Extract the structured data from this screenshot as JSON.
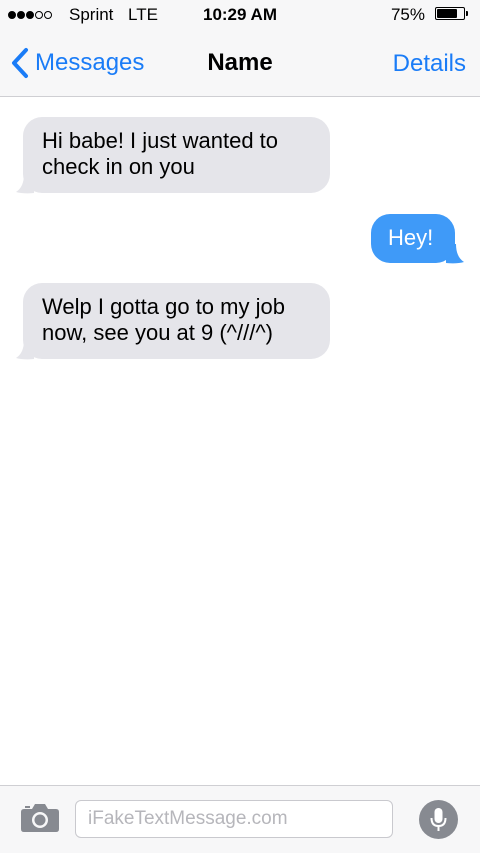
{
  "status_bar": {
    "signal_filled": 3,
    "signal_total": 5,
    "carrier": "Sprint",
    "network": "LTE",
    "time": "10:29 AM",
    "battery_percent": "75%",
    "battery_level": 0.75
  },
  "nav": {
    "back_label": "Messages",
    "title": "Name",
    "details_label": "Details",
    "back_icon": "chevron-left-icon"
  },
  "messages": [
    {
      "direction": "incoming",
      "text": "Hi babe! I just wanted to check in on you"
    },
    {
      "direction": "outgoing",
      "text": "Hey!"
    },
    {
      "direction": "incoming",
      "text": "Welp I gotta go to my job now, see you at 9 (^///^)"
    }
  ],
  "input_bar": {
    "placeholder": "iFakeTextMessage.com",
    "value": "",
    "camera_icon": "camera-icon",
    "mic_icon": "microphone-icon"
  },
  "colors": {
    "accent": "#1a7cf7",
    "incoming_bubble": "#e5e5ea",
    "outgoing_bubble": "#3f9af8",
    "bar_background": "#f7f7f8",
    "mic_button": "#878a91"
  }
}
